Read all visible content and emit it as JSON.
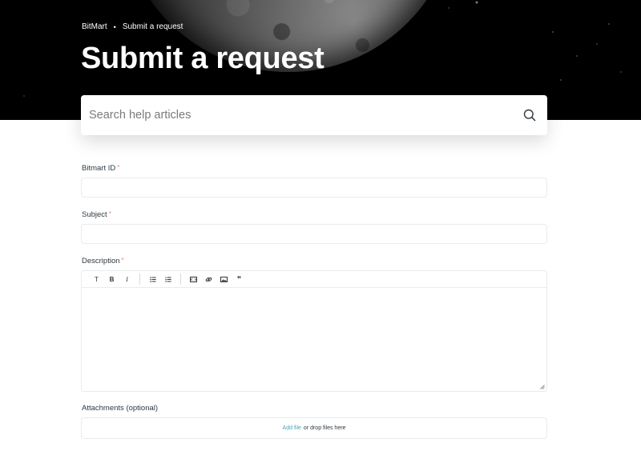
{
  "breadcrumb": {
    "home": "BitMart",
    "separator": "•",
    "current": "Submit a request"
  },
  "page": {
    "title": "Submit a request"
  },
  "search": {
    "placeholder": "Search help articles",
    "icon": "search-icon"
  },
  "form": {
    "required_marker": "*",
    "bitmart_id": {
      "label": "Bitmart ID",
      "value": ""
    },
    "subject": {
      "label": "Subject",
      "value": ""
    },
    "description": {
      "label": "Description",
      "toolbar": [
        {
          "name": "text-style",
          "glyph": "T"
        },
        {
          "name": "bold",
          "glyph": "B"
        },
        {
          "name": "italic",
          "glyph": "I"
        },
        {
          "name": "bulleted-list",
          "glyph": ""
        },
        {
          "name": "numbered-list",
          "glyph": ""
        },
        {
          "name": "code-block",
          "glyph": ""
        },
        {
          "name": "link",
          "glyph": ""
        },
        {
          "name": "image",
          "glyph": ""
        },
        {
          "name": "quote",
          "glyph": "❞"
        }
      ]
    },
    "attachments": {
      "label": "Attachments (optional)",
      "add_file": "Add file",
      "drop_text": "or drop files here"
    }
  },
  "colors": {
    "link": "#49a4b8",
    "required": "#e8837a",
    "border": "#e9ebed"
  }
}
